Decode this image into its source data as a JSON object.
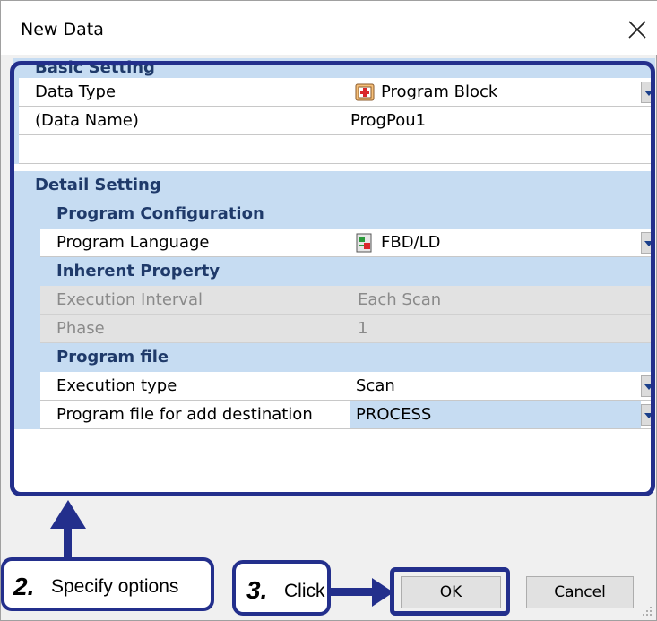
{
  "window": {
    "title": "New Data"
  },
  "sections": {
    "basic": "Basic Setting",
    "detail": "Detail Setting",
    "program_configuration": "Program Configuration",
    "inherent_property": "Inherent Property",
    "program_file": "Program file"
  },
  "fields": {
    "data_type": {
      "label": "Data Type",
      "value": "Program Block",
      "icon": "program-block-icon"
    },
    "data_name": {
      "label": "(Data Name)",
      "value": "ProgPou1"
    },
    "program_language": {
      "label": "Program Language",
      "value": "FBD/LD",
      "icon": "fbd-ld-icon"
    },
    "execution_interval": {
      "label": "Execution Interval",
      "value": "Each Scan"
    },
    "phase": {
      "label": "Phase",
      "value": "1"
    },
    "execution_type": {
      "label": "Execution type",
      "value": "Scan"
    },
    "program_file_dest": {
      "label": "Program file for add destination",
      "value": "PROCESS"
    }
  },
  "buttons": {
    "ok": "OK",
    "cancel": "Cancel"
  },
  "callouts": {
    "step2": {
      "number": "2.",
      "text": "Specify options"
    },
    "step3": {
      "number": "3.",
      "text": "Click"
    }
  },
  "colors": {
    "accent": "#232f8c",
    "section_header": "#c6dcf2",
    "section_text": "#1f3a6a"
  }
}
